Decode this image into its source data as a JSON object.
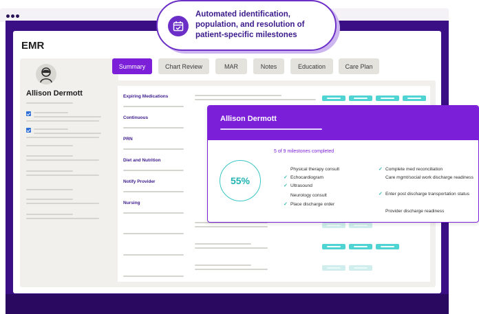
{
  "callout": {
    "text": "Automated identification, population, and resolution of patient-specific milestones",
    "icon": "calendar-check-icon"
  },
  "app": {
    "title": "EMR"
  },
  "patient": {
    "name": "Allison Dermott"
  },
  "tabs": [
    "Summary",
    "Chart Review",
    "MAR",
    "Notes",
    "Education",
    "Care Plan"
  ],
  "active_tab": "Summary",
  "rows": [
    "Expiring Medications",
    "Continuous",
    "PRN",
    "Diet and Nutrition",
    "Notify Provider",
    "Nursing"
  ],
  "card": {
    "patient_name": "Allison Dermott",
    "progress_label": "55%",
    "progress_fraction": 0.55,
    "milestones_count": "5 of 9 milestones completed",
    "left_milestones": [
      {
        "label": "Physical therapy consult",
        "done": false
      },
      {
        "label": "Echocardiogram",
        "done": true
      },
      {
        "label": "Ultrasound",
        "done": true
      },
      {
        "label": "Neurology consult",
        "done": false
      },
      {
        "label": "Place discharge order",
        "done": true
      }
    ],
    "right_milestones": [
      {
        "label": "Complete med reconciliation",
        "done": true
      },
      {
        "label": "Care mgmt/social work discharge readiness",
        "done": false
      },
      {
        "label": "Enter post discharge transportation status",
        "done": true
      },
      {
        "label": "Provider discharge readiness",
        "done": false
      }
    ]
  },
  "colors": {
    "brand_purple": "#7b1fd8",
    "accent_teal": "#4fd3d3",
    "frame_purple": "#3a0f86"
  }
}
